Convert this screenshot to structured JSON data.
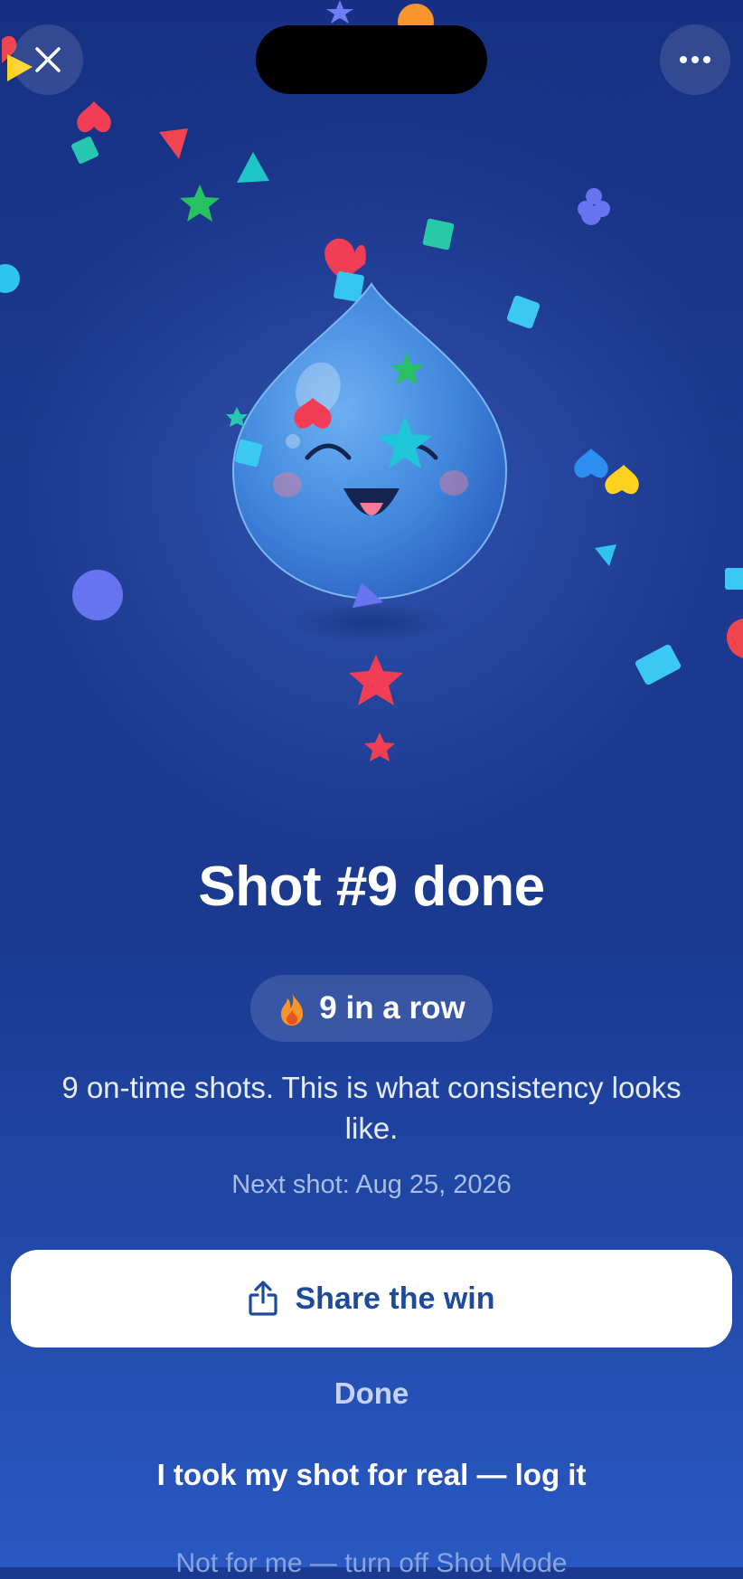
{
  "header": {
    "close_icon": "close-icon",
    "more_icon": "more-horizontal-icon"
  },
  "hero": {
    "character": "water-drop-mascot",
    "decoration": "confetti"
  },
  "title": "Shot #9 done",
  "streak": {
    "icon": "fire-icon",
    "label": "9 in a row"
  },
  "message": "9 on-time shots. This is what consistency looks like.",
  "next_shot": "Next shot: Aug 25, 2026",
  "actions": {
    "share_label": "Share the win",
    "share_icon": "share-icon",
    "done_label": "Done",
    "log_label": "I took my shot for real — log it",
    "turn_off_label": "Not for me — turn off Shot Mode"
  },
  "colors": {
    "background": "#1f4399",
    "accent_text": "#1e4a9c",
    "button_bg": "#ffffff"
  }
}
